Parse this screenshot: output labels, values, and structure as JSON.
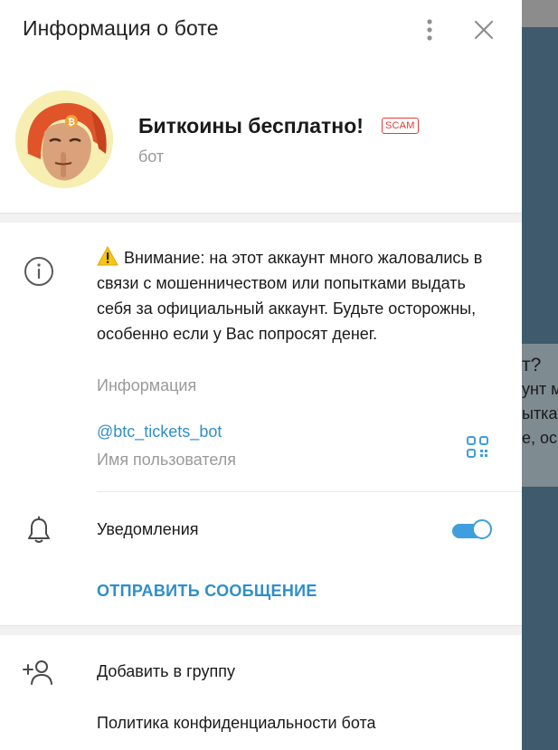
{
  "header": {
    "title": "Информация о боте"
  },
  "profile": {
    "name": "Биткоины бесплатно!",
    "badge": "SCAM",
    "subtitle": "бот"
  },
  "info": {
    "warning_text": "Внимание: на этот аккаунт много жаловались в связи с мошенничеством или попытками выдать себя за официальный аккаунт. Будьте осторожны, особенно если у Вас попросят денег.",
    "label": "Информация"
  },
  "username": {
    "value": "@btc_tickets_bot",
    "label": "Имя пользователя"
  },
  "notifications": {
    "label": "Уведомления",
    "enabled": true
  },
  "actions": {
    "send_message": "ОТПРАВИТЬ СООБЩЕНИЕ",
    "add_to_group": "Добавить в группу",
    "privacy_policy": "Политика конфиденциальности бота"
  },
  "background_chat": {
    "lines": [
      "т?",
      "унт м",
      "ыткам",
      "е, осо"
    ]
  },
  "colors": {
    "accent": "#2e8fc9",
    "scam": "#e53935",
    "toggle": "#3f9ede",
    "chat_bg": "#3f5a6c"
  },
  "icons": {
    "more": "more-vertical-icon",
    "close": "close-icon",
    "info": "info-icon",
    "warning": "warning-icon",
    "qr": "qr-code-icon",
    "bell": "bell-icon",
    "add_user": "add-user-icon"
  }
}
